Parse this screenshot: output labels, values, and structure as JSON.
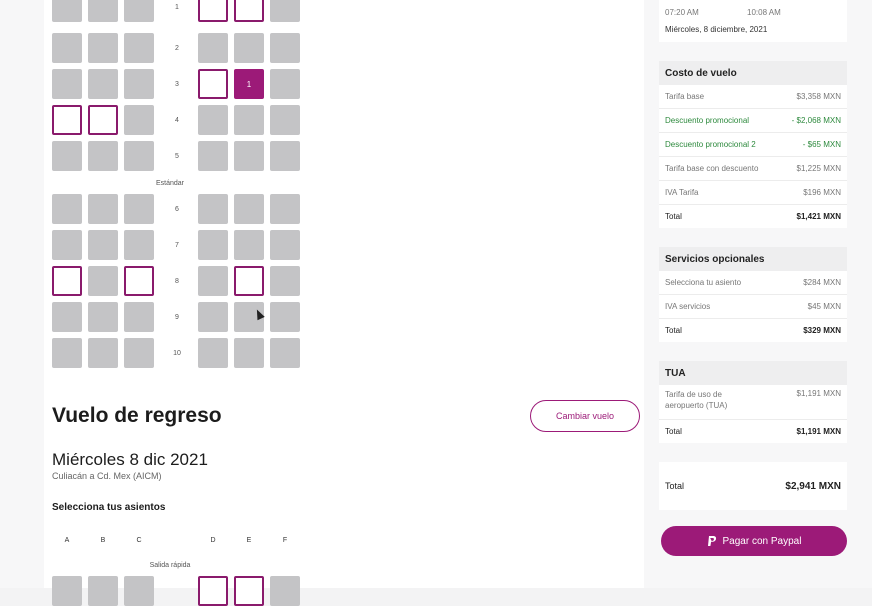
{
  "seatmap": {
    "row_numbers": [
      "1",
      "2",
      "3",
      "4",
      "5",
      "6",
      "7",
      "8",
      "9",
      "10"
    ],
    "section_label": "Estándar",
    "selected_seat_label": "1"
  },
  "return_flight": {
    "title": "Vuelo de regreso",
    "date": "Miércoles 8 dic 2021",
    "route": "Culiacán a Cd. Mex (AICM)",
    "select_label": "Selecciona tus asientos",
    "change_button": "Cambiar vuelo",
    "columns": [
      "A",
      "B",
      "C",
      "D",
      "E",
      "F"
    ],
    "section_label": "Salida rápida"
  },
  "flight_info": {
    "departure": "07:20 AM",
    "arrival": "10:08 AM",
    "date": "Miércoles, 8 diciembre, 2021"
  },
  "cost": {
    "header": "Costo de vuelo",
    "lines": [
      {
        "label": "Tarifa base",
        "value": "$3,358 MXN"
      },
      {
        "label": "Descuento promocional",
        "value": "- $2,068 MXN"
      },
      {
        "label": "Descuento promocional 2",
        "value": "- $65 MXN"
      },
      {
        "label": "Tarifa base con descuento",
        "value": "$1,225 MXN"
      },
      {
        "label": "IVA Tarifa",
        "value": "$196 MXN"
      }
    ],
    "total_label": "Total",
    "total_value": "$1,421 MXN"
  },
  "services": {
    "header": "Servicios opcionales",
    "lines": [
      {
        "label": "Selecciona tu asiento",
        "value": "$284 MXN"
      },
      {
        "label": "IVA servicios",
        "value": "$45 MXN"
      }
    ],
    "total_label": "Total",
    "total_value": "$329 MXN"
  },
  "tua": {
    "header": "TUA",
    "line_label": "Tarifa de uso de aeropuerto (TUA)",
    "line_value": "$1,191 MXN",
    "total_label": "Total",
    "total_value": "$1,191 MXN"
  },
  "grand_total": {
    "label": "Total",
    "value": "$2,941 MXN"
  },
  "pay_button": "Pagar con Paypal",
  "colors": {
    "brand": "#9c1a78",
    "promo": "#2e8a3e",
    "occupied": "#c4c4c6"
  }
}
